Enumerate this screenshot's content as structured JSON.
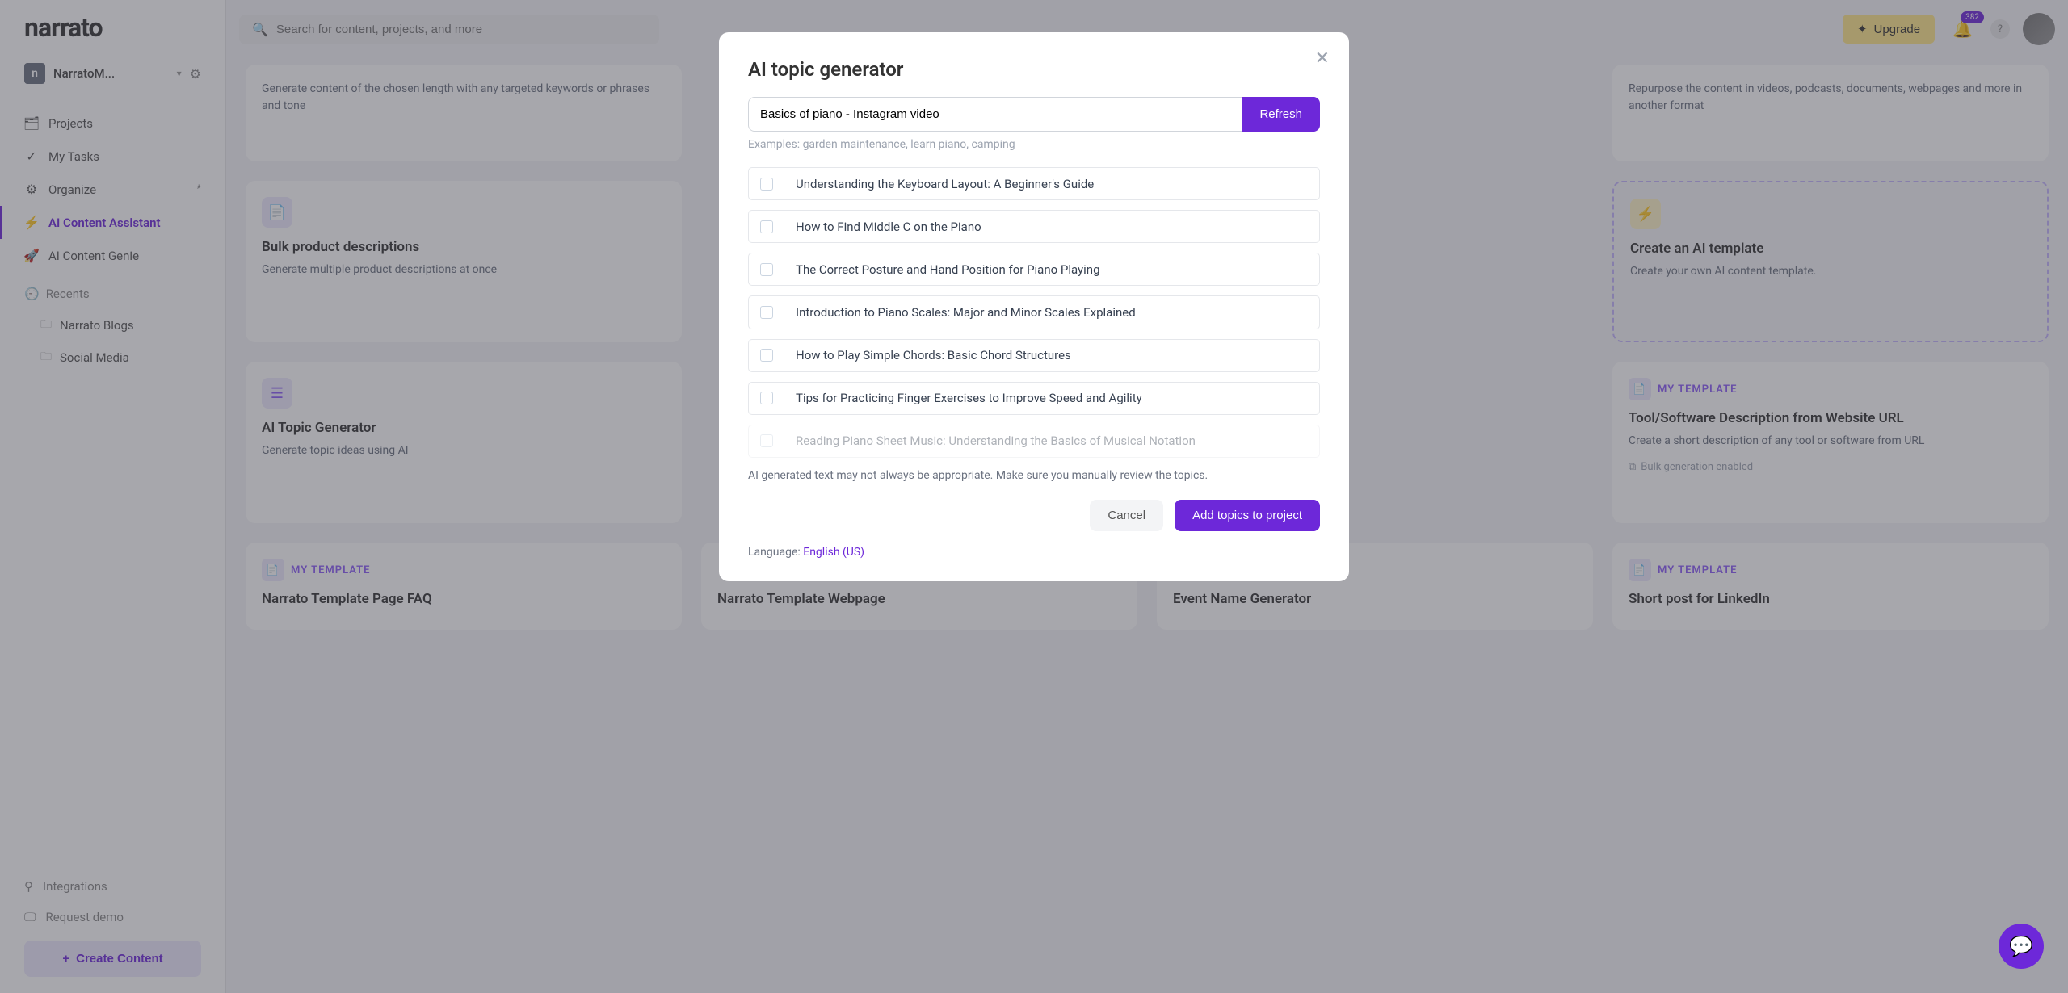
{
  "brand": "narrato",
  "workspace": {
    "badge": "n",
    "name": "NarratoM..."
  },
  "search": {
    "placeholder": "Search for content, projects, and more"
  },
  "nav": {
    "projects": "Projects",
    "tasks": "My Tasks",
    "organize": "Organize",
    "organize_badge": "*",
    "ai_assistant": "AI Content Assistant",
    "ai_genie": "AI Content Genie"
  },
  "recents": {
    "label": "Recents",
    "items": [
      "Narrato Blogs",
      "Social Media"
    ]
  },
  "sidebar_bottom": {
    "integrations": "Integrations",
    "request_demo": "Request demo",
    "create_content": "Create Content"
  },
  "topbar": {
    "upgrade": "Upgrade",
    "notif_count": "382"
  },
  "cards": {
    "row0": {
      "keyword_desc": "Generate content of the chosen length with any targeted keywords or phrases and tone",
      "repurpose_desc": "Repurpose the content in videos, podcasts, documents, webpages and more in another format"
    },
    "bulk": {
      "title": "Bulk product descriptions",
      "desc": "Generate multiple product descriptions at once"
    },
    "ai_template": {
      "title": "Create an AI template",
      "desc": "Create your own AI content template."
    },
    "ai_topic": {
      "title": "AI Topic Generator",
      "desc": "Generate topic ideas using AI"
    },
    "tool_desc": {
      "label": "MY TEMPLATE",
      "title": "Tool/Software Description from Website URL",
      "desc": "Create a short description of any tool or software from URL",
      "bulk_note": "Bulk generation enabled"
    },
    "faq": {
      "label": "MY TEMPLATE",
      "title": "Narrato Template Page FAQ"
    },
    "webpage": {
      "title": "Narrato Template Webpage"
    },
    "event": {
      "title": "Event Name Generator"
    },
    "linkedin": {
      "label": "MY TEMPLATE",
      "title": "Short post for LinkedIn"
    }
  },
  "modal": {
    "title": "AI topic generator",
    "prompt": "Basics of piano - Instagram video",
    "refresh": "Refresh",
    "examples": "Examples: garden maintenance, learn piano, camping",
    "topics": [
      "Understanding the Keyboard Layout: A Beginner's Guide",
      "How to Find Middle C on the Piano",
      "The Correct Posture and Hand Position for Piano Playing",
      "Introduction to Piano Scales: Major and Minor Scales Explained",
      "How to Play Simple Chords: Basic Chord Structures",
      "Tips for Practicing Finger Exercises to Improve Speed and Agility",
      "Reading Piano Sheet Music: Understanding the Basics of Musical Notation"
    ],
    "disclaimer": "AI generated text may not always be appropriate. Make sure you manually review the topics.",
    "cancel": "Cancel",
    "add": "Add topics to project",
    "language_label": "Language: ",
    "language_value": "English (US)"
  }
}
